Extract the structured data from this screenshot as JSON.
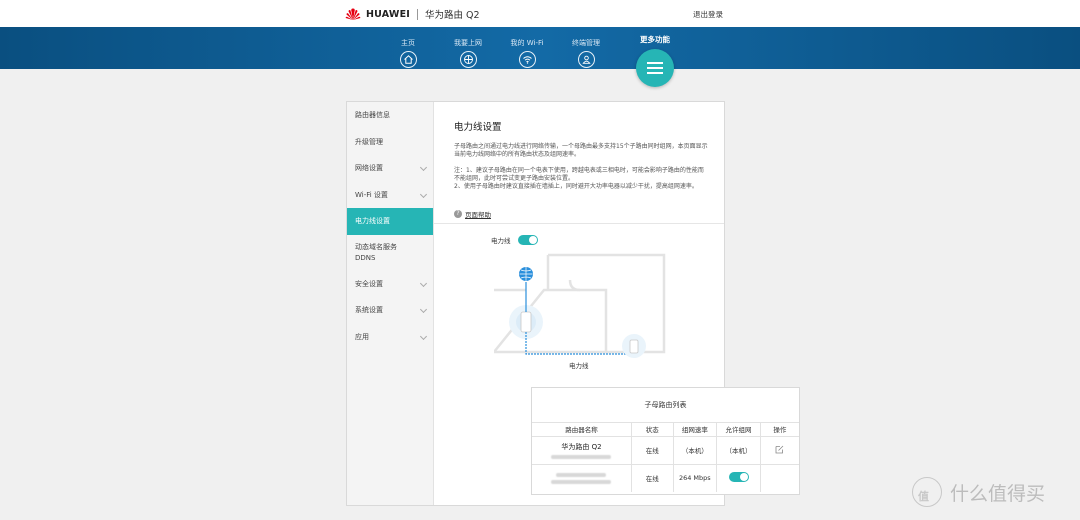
{
  "header": {
    "logo_text": "HUAWEI",
    "model": "华为路由 Q2",
    "logout": "退出登录"
  },
  "nav": {
    "items": [
      {
        "label": "主页",
        "icon": "home-icon"
      },
      {
        "label": "我要上网",
        "icon": "globe-icon"
      },
      {
        "label": "我的 Wi-Fi",
        "icon": "wifi-icon"
      },
      {
        "label": "终端管理",
        "icon": "user-icon"
      }
    ],
    "more_label": "更多功能",
    "more_icon": "menu-icon"
  },
  "sidebar": {
    "items": [
      {
        "label": "路由器信息",
        "chevron": false
      },
      {
        "label": "升级管理",
        "chevron": false
      },
      {
        "label": "网络设置",
        "chevron": true
      },
      {
        "label": "Wi-Fi 设置",
        "chevron": true
      },
      {
        "label": "电力线设置",
        "chevron": false,
        "active": true
      },
      {
        "label": "动态域名服务\nDDNS",
        "chevron": false
      },
      {
        "label": "安全设置",
        "chevron": true
      },
      {
        "label": "系统设置",
        "chevron": true
      },
      {
        "label": "应用",
        "chevron": true
      }
    ]
  },
  "content": {
    "title": "电力线设置",
    "description": "子母路由之间通过电力线进行网络传输，一个母路由最多支持15个子路由同时组网，本页面显示当前电力线网络中的所有路由状态及组网速率。",
    "note_1": "注：1、建议子母路由在同一个电表下使用，跨越电表或三相电时，可能会影响子路由的性能而不能组网，此时可尝试变更子路由安装位置。",
    "note_2": "2、使用子母路由时建议直接插在墙插上，同时避开大功率电器以减少干扰，提高组网速率。",
    "help_label": "页面帮助",
    "plc_toggle_label": "电力线",
    "plc_toggle_on": true,
    "diagram_caption": "电力线"
  },
  "table": {
    "title": "子母路由列表",
    "columns": [
      "路由器名称",
      "状态",
      "组网速率",
      "允许组网",
      "操作"
    ],
    "rows": [
      {
        "name": "华为路由 Q2",
        "status": "在线",
        "rate": "（本机）",
        "allow": "（本机）",
        "action": "edit-icon"
      },
      {
        "name": "",
        "status": "在线",
        "rate": "264 Mbps",
        "allow_toggle": true,
        "action": ""
      }
    ]
  },
  "watermark": {
    "symbol": "值",
    "text": "什么值得买"
  },
  "colors": {
    "nav_blue": "#0f5e95",
    "accent_teal": "#26b5b5",
    "brand_red": "#e60012"
  }
}
